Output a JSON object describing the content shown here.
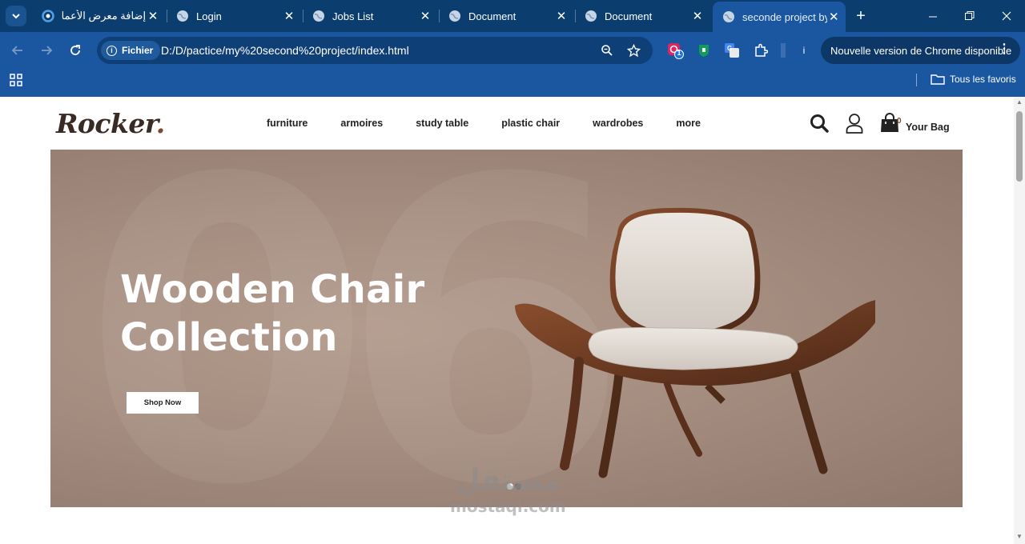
{
  "browser": {
    "tabs": [
      {
        "title": "إضافة معرض الأعما",
        "favicon": "circle-favicon-icon"
      },
      {
        "title": "Login",
        "favicon": "globe-icon"
      },
      {
        "title": "Jobs List",
        "favicon": "globe-icon"
      },
      {
        "title": "Document",
        "favicon": "globe-icon"
      },
      {
        "title": "Document",
        "favicon": "globe-icon"
      },
      {
        "title": "seconde project by",
        "favicon": "globe-icon",
        "active": true
      }
    ],
    "address_chip": "Fichier",
    "url": "D:/D/pactice/my%20second%20project/index.html",
    "extension_badge": "1",
    "info_text": "i",
    "update_text": "Nouvelle version de Chrome disponible",
    "bookmarks_all": "Tous les favoris",
    "colors": {
      "tabstrip": "#0b3d6e",
      "toolbar": "#1a57a0",
      "omnibox": "#0e3f76"
    }
  },
  "site": {
    "logo_text": "Rocker",
    "logo_dot": ".",
    "nav": [
      "furniture",
      "armoires",
      "study table",
      "plastic chair",
      "wardrobes",
      "more"
    ],
    "bag_count": "0",
    "bag_label": "Your Bag",
    "hero": {
      "ghost_text": "06",
      "title_line1": "Wooden Chair",
      "title_line2": "Collection",
      "button": "Shop Now",
      "slides": 2,
      "active_slide": 1
    },
    "watermark_ar": "مستقل",
    "watermark_en": "mostaql.com",
    "colors": {
      "hero_bg": "#a58d80",
      "brand_brown": "#7b4a2b",
      "text_dark": "#222222"
    }
  }
}
